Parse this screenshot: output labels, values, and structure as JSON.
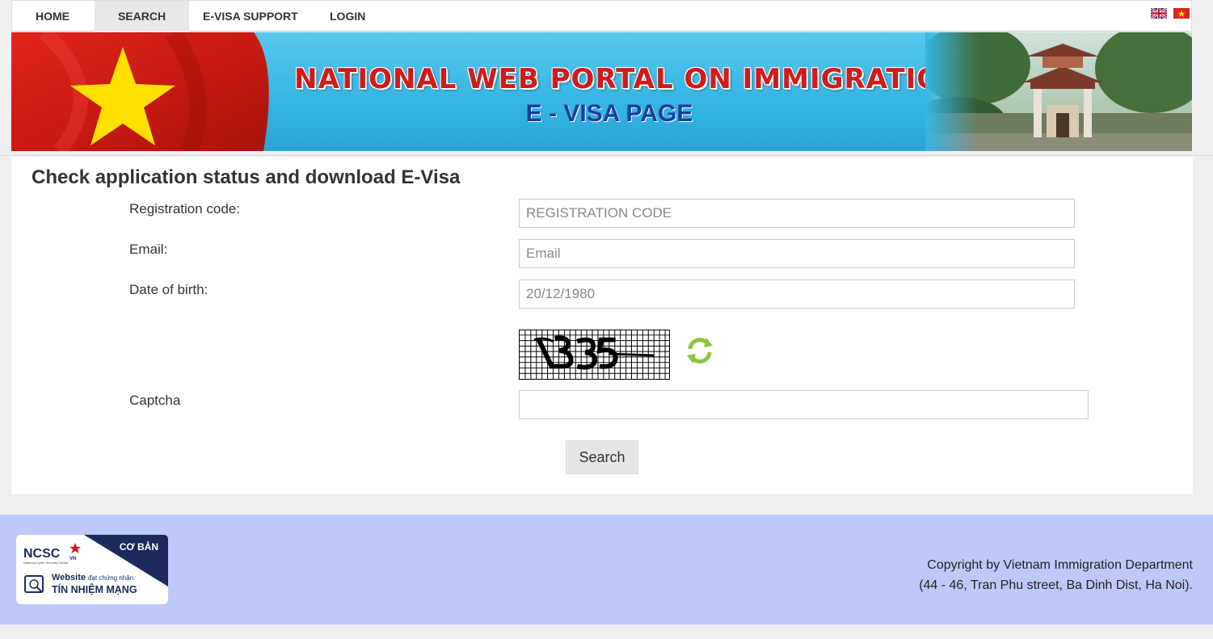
{
  "nav": {
    "items": [
      {
        "label": "HOME"
      },
      {
        "label": "SEARCH"
      },
      {
        "label": "E-VISA SUPPORT"
      },
      {
        "label": "LOGIN"
      }
    ],
    "active_index": 1,
    "flags": [
      "uk-flag-icon",
      "vietnam-flag-icon"
    ]
  },
  "banner": {
    "title": "NATIONAL WEB PORTAL ON IMMIGRATION",
    "subtitle": "E - VISA PAGE"
  },
  "form": {
    "title": "Check application status and download E-Visa",
    "registration_label": "Registration code:",
    "registration_placeholder": "REGISTRATION CODE",
    "email_label": "Email:",
    "email_placeholder": "Email",
    "dob_label": "Date of birth:",
    "dob_value": "20/12/1980",
    "captcha_label": "Captcha",
    "captcha_value": "",
    "search_label": "Search"
  },
  "footer": {
    "badge": {
      "brand": "NCSC",
      "brand_suffix": "VN",
      "brand_caption": "National Cyber Security Center",
      "level": "CƠ BẢN",
      "line1_bold": "Website",
      "line1_rest": "đạt chứng nhận",
      "line2": "TÍN NHIỆM MẠNG"
    },
    "copyright_line1": "Copyright by Vietnam Immigration Department",
    "copyright_line2": "(44 - 46, Tran Phu street, Ba Dinh Dist, Ha Noi)."
  },
  "colors": {
    "footer_bg": "#bfc9f8",
    "title_red": "#d11a1a",
    "subtitle_blue": "#1a3f9a",
    "refresh_green": "#8cc63f"
  }
}
